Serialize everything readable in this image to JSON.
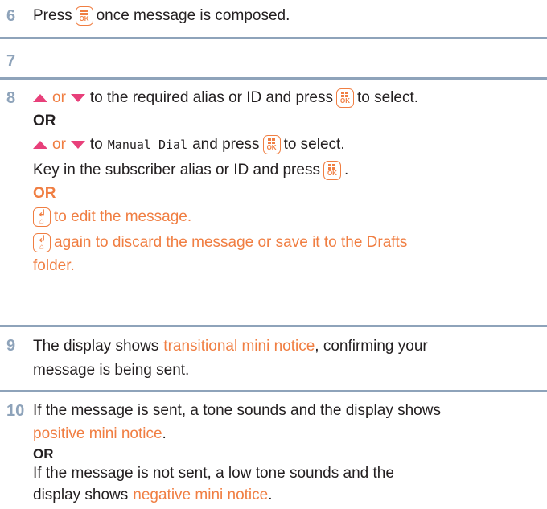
{
  "colors": {
    "accent": "#f07e42",
    "step_number": "#8ea3ba",
    "arrow": "#e8407a",
    "text": "#231f20"
  },
  "icons": {
    "menu_ok_key": "menu-ok-key-icon",
    "back_home_key": "back-home-key-icon",
    "up_arrow": "up-arrow-icon",
    "down_arrow": "down-arrow-icon"
  },
  "steps": [
    {
      "number": "6",
      "text_before": "Press",
      "text_after": "once message is composed."
    },
    {
      "number": "7"
    },
    {
      "number": "8",
      "line1": {
        "or": "or",
        "text": "to the required alias or ID and press",
        "end": "to select."
      },
      "or_label": "OR",
      "line2": {
        "or": "or",
        "pre": "to",
        "mono": "Manual Dial",
        "text": "and press",
        "end": "to select."
      },
      "line3": {
        "text": "Key in the subscriber alias or ID and press",
        "end": "."
      },
      "or_label_2": "OR",
      "line4": {
        "text": "to edit the message."
      },
      "line5": {
        "text": "again to discard the message or save it to the Drafts",
        "text2": "folder."
      }
    },
    {
      "number": "9",
      "text_before": "The display shows",
      "highlight": "transitional mini notice",
      "text_after": ", confirming your",
      "text2": "message is being sent."
    },
    {
      "number": "10",
      "line1": "If the message is sent, a tone sounds and the display shows",
      "highlight1": "positive mini notice",
      "end1": ".",
      "or_label": "OR",
      "line2": "If the message is not sent, a low tone sounds and the",
      "line3": "display shows",
      "highlight2": "negative mini notice",
      "end2": "."
    }
  ]
}
